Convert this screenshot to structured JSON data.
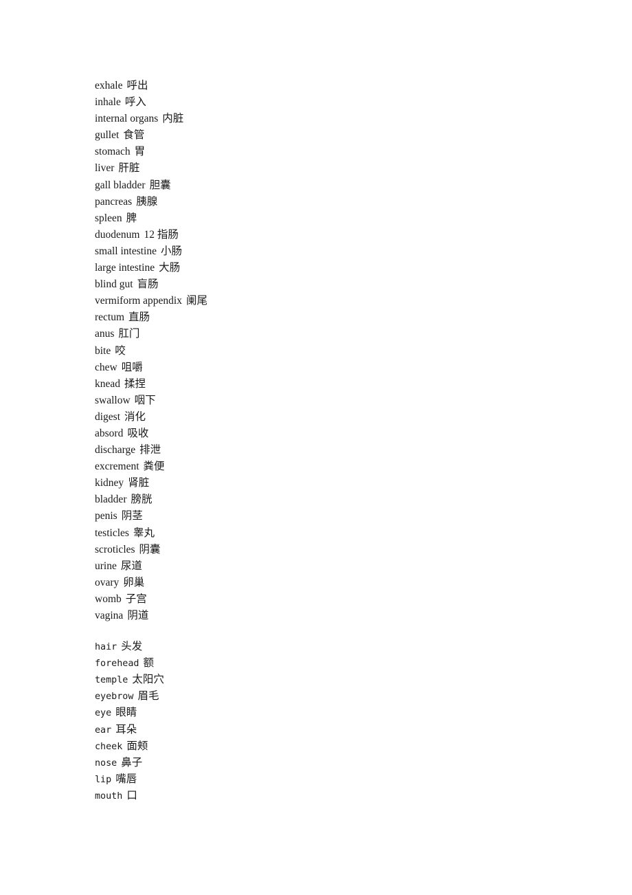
{
  "document": {
    "background_color": "#ffffff",
    "text_color": "#1a1a1a",
    "blocks": [
      {
        "id": "internal-organs-and-functions",
        "typeface": "serif",
        "entries": [
          {
            "term": "exhale",
            "gloss": "呼出"
          },
          {
            "term": "inhale",
            "gloss": "呼入"
          },
          {
            "term": "internal organs",
            "gloss": "内脏"
          },
          {
            "term": "gullet",
            "gloss": "食管"
          },
          {
            "term": "stomach",
            "gloss": "胃"
          },
          {
            "term": "liver",
            "gloss": "肝脏"
          },
          {
            "term": "gall bladder",
            "gloss": "胆囊"
          },
          {
            "term": "pancreas",
            "gloss": "胰腺"
          },
          {
            "term": "spleen",
            "gloss": "脾"
          },
          {
            "term": "duodenum",
            "gloss": "12 指肠"
          },
          {
            "term": "small intestine",
            "gloss": "小肠"
          },
          {
            "term": "large intestine",
            "gloss": "大肠"
          },
          {
            "term": "blind gut",
            "gloss": "盲肠"
          },
          {
            "term": "vermiform appendix",
            "gloss": "阑尾"
          },
          {
            "term": "rectum",
            "gloss": "直肠"
          },
          {
            "term": "anus",
            "gloss": "肛门"
          },
          {
            "term": "bite",
            "gloss": "咬"
          },
          {
            "term": "chew",
            "gloss": "咀嚼"
          },
          {
            "term": "knead",
            "gloss": "揉捏"
          },
          {
            "term": "swallow",
            "gloss": "咽下"
          },
          {
            "term": "digest",
            "gloss": "消化"
          },
          {
            "term": "absord",
            "gloss": "吸收"
          },
          {
            "term": "discharge",
            "gloss": "排泄"
          },
          {
            "term": "excrement",
            "gloss": "粪便"
          },
          {
            "term": "kidney",
            "gloss": "肾脏"
          },
          {
            "term": "bladder",
            "gloss": "膀胱"
          },
          {
            "term": "penis",
            "gloss": "阴茎"
          },
          {
            "term": "testicles",
            "gloss": "睾丸"
          },
          {
            "term": "scroticles",
            "gloss": "阴囊"
          },
          {
            "term": "urine",
            "gloss": "尿道"
          },
          {
            "term": "ovary",
            "gloss": "卵巢"
          },
          {
            "term": "womb",
            "gloss": "子宫"
          },
          {
            "term": "vagina",
            "gloss": "阴道"
          }
        ]
      },
      {
        "id": "head-and-face",
        "typeface": "monospace",
        "entries": [
          {
            "term": "hair",
            "gloss": "头发"
          },
          {
            "term": "forehead",
            "gloss": "额"
          },
          {
            "term": "temple",
            "gloss": "太阳穴"
          },
          {
            "term": "eyebrow",
            "gloss": "眉毛"
          },
          {
            "term": "eye",
            "gloss": "眼睛"
          },
          {
            "term": "ear",
            "gloss": "耳朵"
          },
          {
            "term": "cheek",
            "gloss": "面颊"
          },
          {
            "term": "nose",
            "gloss": "鼻子"
          },
          {
            "term": "lip",
            "gloss": "嘴唇"
          },
          {
            "term": "mouth",
            "gloss": "口"
          }
        ]
      }
    ]
  }
}
